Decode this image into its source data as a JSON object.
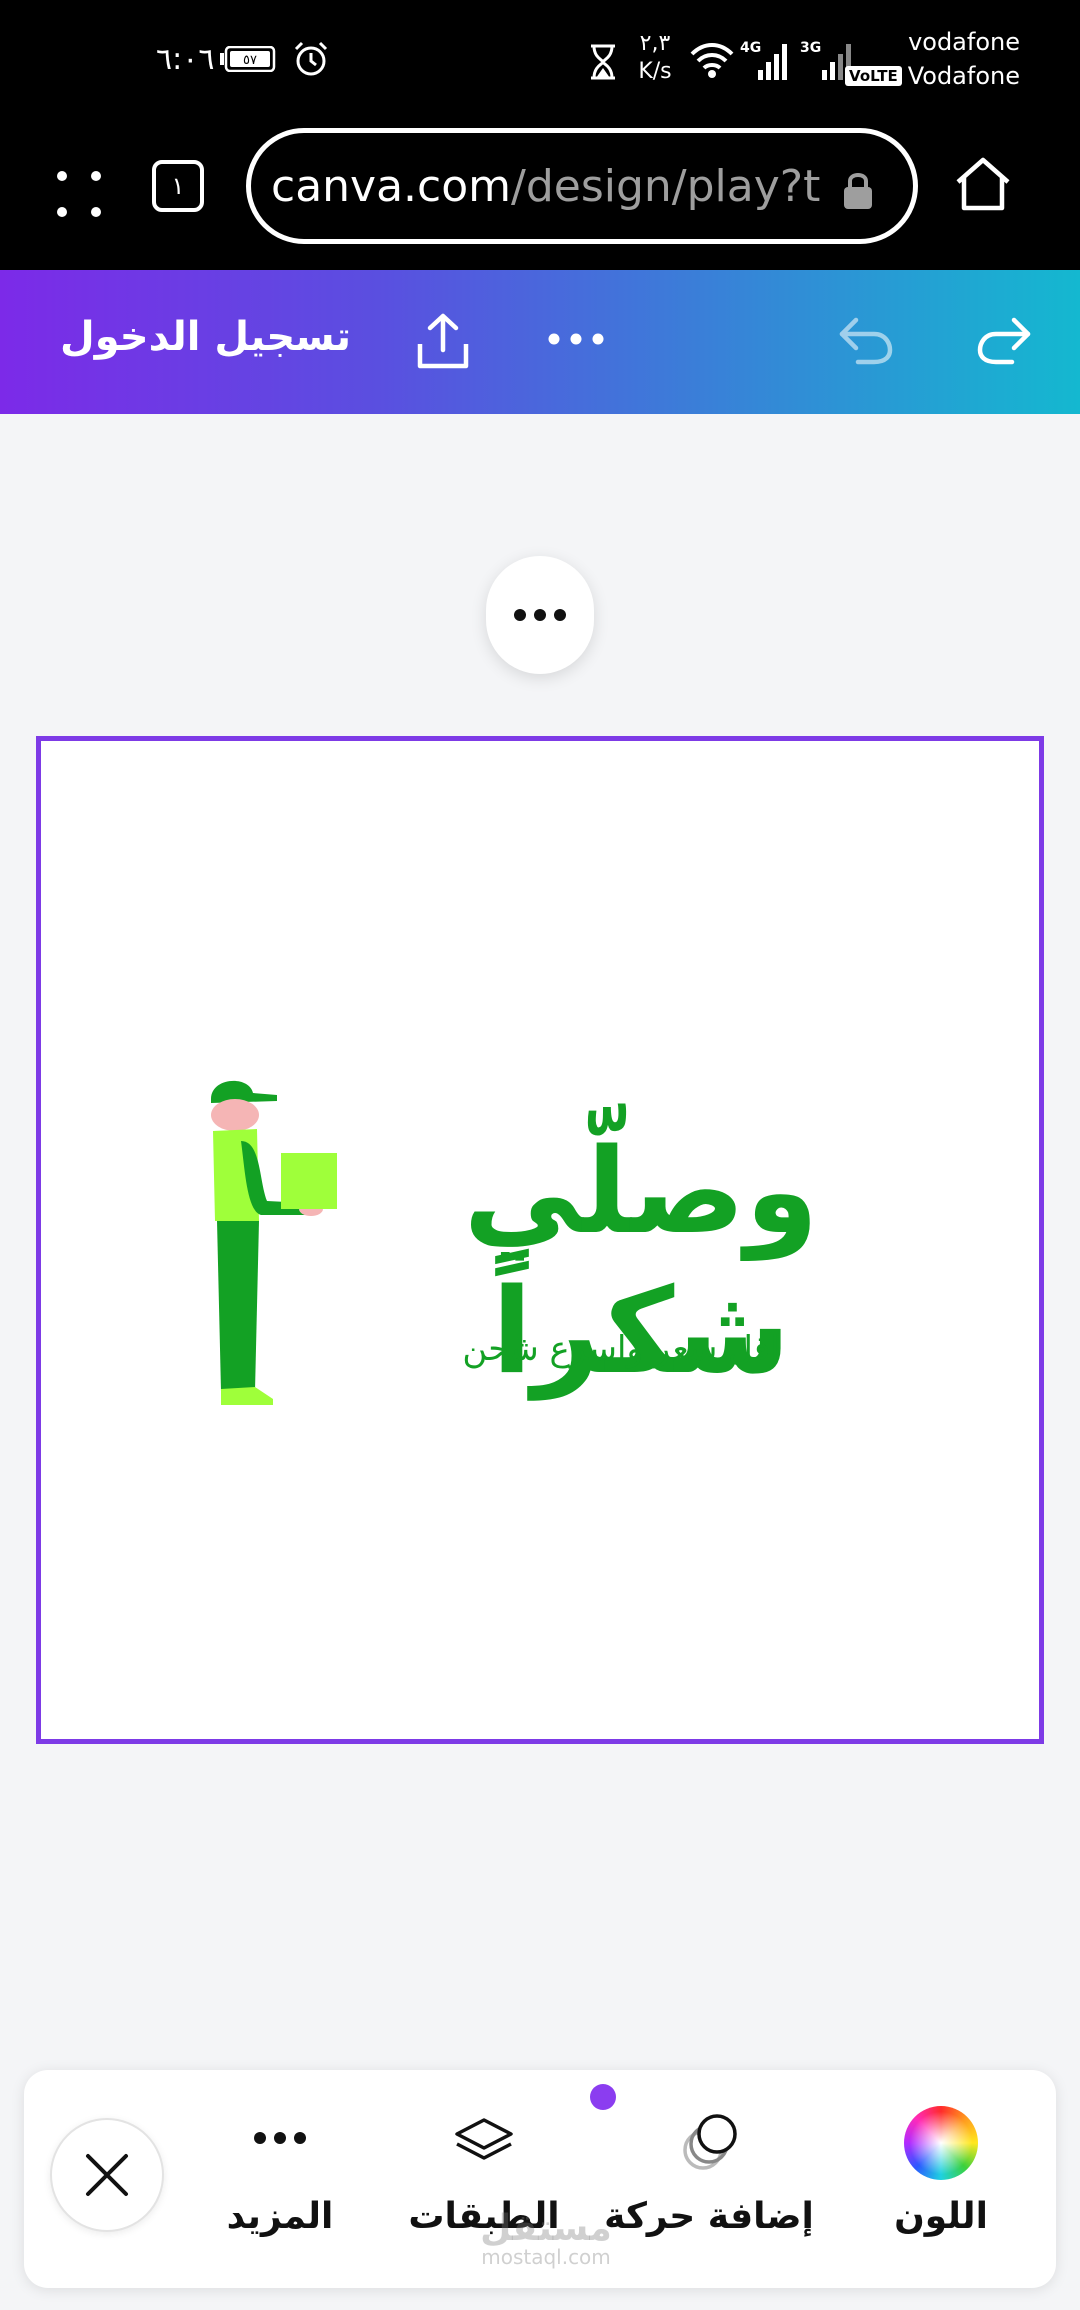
{
  "status_bar": {
    "time": "٦:٠٦",
    "battery": "٥٧",
    "speed_value": "٢,٣",
    "speed_unit": "K/s",
    "network_1": "4G",
    "network_2": "3G",
    "carrier_1": "vodafone",
    "carrier_2": "Vodafone",
    "volte": "VoLTE"
  },
  "browser": {
    "tab_count": "١",
    "url_host": "canva.com",
    "url_path": "/design/play?t"
  },
  "canva_header": {
    "login_label": "تسجيل الدخول",
    "gradient_start": "#7c2ae8",
    "gradient_end": "#14b8d0"
  },
  "design": {
    "brand_name": "وصلّي شكراً",
    "tagline": "اقل سعر واسرع شحن",
    "brand_color": "#13a124",
    "selection_color": "#7d3ae6"
  },
  "toolbar": {
    "more_label": "المزيد",
    "layers_label": "الطبقات",
    "animate_label": "إضافة حركة",
    "color_label": "اللون"
  },
  "watermark": {
    "line1": "مستقل",
    "line2": "mostaql.com"
  }
}
